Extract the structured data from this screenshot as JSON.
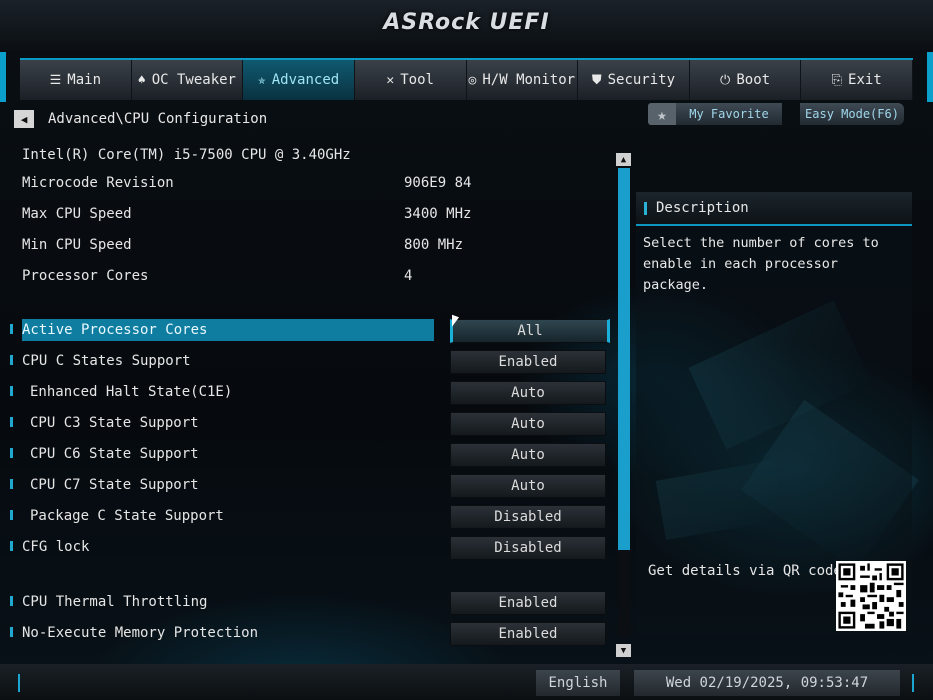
{
  "header": {
    "brand": "ASRock",
    "product": "UEFI"
  },
  "tabs": [
    {
      "label": "Main",
      "icon": "list-icon",
      "glyph": "☰",
      "active": false
    },
    {
      "label": "OC Tweaker",
      "icon": "rocket-icon",
      "glyph": "♠",
      "active": false
    },
    {
      "label": "Advanced",
      "icon": "star-icon",
      "glyph": "✯",
      "active": true
    },
    {
      "label": "Tool",
      "icon": "tools-icon",
      "glyph": "✕",
      "active": false
    },
    {
      "label": "H/W Monitor",
      "icon": "monitor-icon",
      "glyph": "◎",
      "active": false
    },
    {
      "label": "Security",
      "icon": "shield-icon",
      "glyph": "⛊",
      "active": false
    },
    {
      "label": "Boot",
      "icon": "power-icon",
      "glyph": "⏻",
      "active": false
    },
    {
      "label": "Exit",
      "icon": "exit-icon",
      "glyph": "⎘",
      "active": false
    }
  ],
  "breadcrumb": "Advanced\\CPU Configuration",
  "favorite": {
    "label": "My Favorite"
  },
  "easy_mode": {
    "label": "Easy Mode(F6)"
  },
  "cpu_name": "Intel(R) Core(TM) i5-7500 CPU @ 3.40GHz",
  "info": [
    {
      "label": "Microcode Revision",
      "value": "906E9 84"
    },
    {
      "label": "Max CPU Speed",
      "value": "3400 MHz"
    },
    {
      "label": "Min CPU Speed",
      "value": "800 MHz"
    },
    {
      "label": "Processor Cores",
      "value": "4"
    }
  ],
  "settings": [
    {
      "label": "Active Processor Cores",
      "value": "All"
    },
    {
      "label": "CPU C States Support",
      "value": "Enabled"
    },
    {
      "label": "Enhanced Halt State(C1E)",
      "value": "Auto"
    },
    {
      "label": "CPU C3 State Support",
      "value": "Auto"
    },
    {
      "label": "CPU C6 State Support",
      "value": "Auto"
    },
    {
      "label": "CPU C7 State Support",
      "value": "Auto"
    },
    {
      "label": "Package C State Support",
      "value": "Disabled"
    },
    {
      "label": "CFG lock",
      "value": "Disabled"
    },
    {
      "label": "CPU Thermal Throttling",
      "value": "Enabled"
    },
    {
      "label": "No-Execute Memory Protection",
      "value": "Enabled"
    }
  ],
  "description": {
    "title": "Description",
    "text": "Select the number of cores to enable in each processor package.",
    "qr_label": "Get details via QR code"
  },
  "footer": {
    "language": "English",
    "datetime": "Wed 02/19/2025, 09:53:47"
  },
  "colors": {
    "accent": "#0e7da0",
    "highlight": "#1a9fcc"
  }
}
